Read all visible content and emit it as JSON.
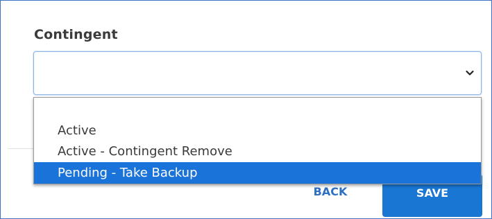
{
  "form": {
    "field_label": "Contingent",
    "selected_value": "",
    "dropdown_icon": "chevron-down-icon"
  },
  "dropdown": {
    "options": [
      {
        "label": ""
      },
      {
        "label": "Active"
      },
      {
        "label": "Active - Contingent Remove"
      },
      {
        "label": "Pending - Take Backup",
        "highlighted": true
      }
    ]
  },
  "actions": {
    "back_label": "BACK",
    "save_label": "SAVE"
  },
  "colors": {
    "accent": "#1976d2",
    "highlight": "#1a73d9",
    "frame_border": "#3f72c4"
  }
}
